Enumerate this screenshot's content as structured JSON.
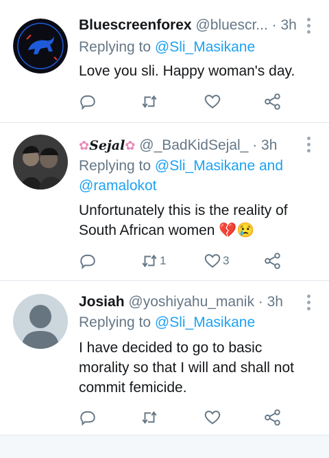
{
  "tweets": [
    {
      "display_name": "Bluescreenforex",
      "handle": "@bluescr...",
      "time": "· 3h",
      "replying_prefix": "Replying to",
      "replying_mentions": [
        "@Sli_Masikane"
      ],
      "replying_extra": "",
      "body": "Love you sli. Happy woman's day.",
      "avatar_text": [
        "BLUE SCREEN",
        "FOREX"
      ],
      "reply_count": "",
      "retweet_count": "",
      "like_count": ""
    },
    {
      "display_name": "Sejal",
      "name_prefix_emoji": "✿",
      "name_suffix_emoji": "✿",
      "handle": "@_BadKidSejal_",
      "time": "· 3h",
      "replying_prefix": "Replying to",
      "replying_mentions": [
        "@Sli_Masikane",
        "@ramalokot"
      ],
      "replying_and": "and",
      "body_line1": "Unfortunately this is the reality of",
      "body_line2": "South African women 💔😢",
      "reply_count": "",
      "retweet_count": "1",
      "like_count": "3"
    },
    {
      "display_name": "Josiah",
      "handle": "@yoshiyahu_manik",
      "time": "· 3h",
      "replying_prefix": "Replying to",
      "replying_mentions": [
        "@Sli_Masikane"
      ],
      "body_line1": "I have decided to go to basic",
      "body_line2": "morality so that I will and shall not",
      "body_line3": "commit femicide.",
      "reply_count": "",
      "retweet_count": "",
      "like_count": ""
    }
  ],
  "icons": {
    "reply": "reply-icon",
    "retweet": "retweet-icon",
    "like": "heart-icon",
    "share": "share-icon",
    "more": "more-vertical-icon"
  },
  "colors": {
    "mention": "#1da1f2",
    "muted": "#657786",
    "divider": "#e1e8ed"
  }
}
